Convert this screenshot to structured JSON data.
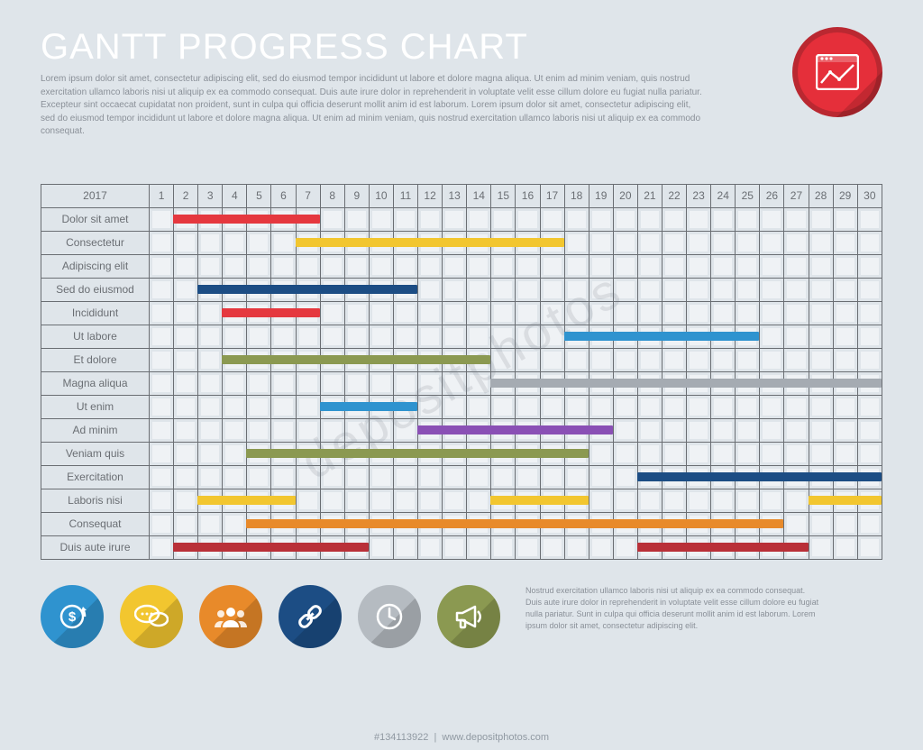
{
  "title": "GANTT PROGRESS CHART",
  "description": "Lorem ipsum dolor sit amet, consectetur adipiscing elit, sed do eiusmod tempor incididunt ut labore et dolore magna aliqua. Ut enim ad minim veniam, quis nostrud exercitation ullamco laboris nisi ut aliquip ex ea commodo consequat. Duis aute irure dolor in reprehenderit in voluptate velit esse cillum dolore eu fugiat nulla pariatur. Excepteur sint occaecat cupidatat non proident, sunt in culpa qui officia deserunt mollit anim id est laborum. Lorem ipsum dolor sit amet, consectetur adipiscing elit, sed do eiusmod tempor incididunt ut labore et dolore magna aliqua. Ut enim ad minim veniam, quis nostrud exercitation ullamco laboris nisi ut aliquip ex ea commodo consequat.",
  "footnote": "Nostrud exercitation ullamco laboris nisi ut aliquip ex ea commodo consequat. Duis aute irure dolor in reprehenderit in voluptate velit esse cillum dolore eu fugiat nulla pariatur. Sunt in culpa qui officia deserunt mollit anim id est laborum. Lorem ipsum dolor sit amet, consectetur adipiscing elit.",
  "watermark": "depositphotos",
  "credits_id": "#134113922",
  "credits_site": "www.depositphotos.com",
  "chart_data": {
    "type": "gantt",
    "year_label": "2017",
    "x": [
      1,
      2,
      3,
      4,
      5,
      6,
      7,
      8,
      9,
      10,
      11,
      12,
      13,
      14,
      15,
      16,
      17,
      18,
      19,
      20,
      21,
      22,
      23,
      24,
      25,
      26,
      27,
      28,
      29,
      30
    ],
    "tasks": [
      {
        "name": "Dolor sit amet",
        "bars": [
          {
            "start": 2,
            "end": 7,
            "color": "#e5383f"
          }
        ]
      },
      {
        "name": "Consectetur",
        "bars": [
          {
            "start": 7,
            "end": 17,
            "color": "#f2c62f"
          }
        ]
      },
      {
        "name": "Adipiscing elit",
        "bars": []
      },
      {
        "name": "Sed do eiusmod",
        "bars": [
          {
            "start": 3,
            "end": 11,
            "color": "#1c4d84"
          }
        ]
      },
      {
        "name": "Incididunt",
        "bars": [
          {
            "start": 4,
            "end": 7,
            "color": "#e5383f"
          }
        ]
      },
      {
        "name": "Ut labore",
        "bars": [
          {
            "start": 18,
            "end": 25,
            "color": "#2f93cf"
          }
        ]
      },
      {
        "name": "Et dolore",
        "bars": [
          {
            "start": 4,
            "end": 14,
            "color": "#8b9951"
          }
        ]
      },
      {
        "name": "Magna aliqua",
        "bars": [
          {
            "start": 15,
            "end": 30,
            "color": "#a5abb2"
          }
        ]
      },
      {
        "name": "Ut enim",
        "bars": [
          {
            "start": 8,
            "end": 11,
            "color": "#2f93cf"
          }
        ]
      },
      {
        "name": "Ad minim",
        "bars": [
          {
            "start": 12,
            "end": 19,
            "color": "#8a50b5"
          }
        ]
      },
      {
        "name": "Veniam quis",
        "bars": [
          {
            "start": 5,
            "end": 18,
            "color": "#8b9951"
          }
        ]
      },
      {
        "name": "Exercitation",
        "bars": [
          {
            "start": 21,
            "end": 30,
            "color": "#1c4d84"
          }
        ]
      },
      {
        "name": "Laboris nisi",
        "bars": [
          {
            "start": 3,
            "end": 6,
            "color": "#f2c62f"
          },
          {
            "start": 15,
            "end": 18,
            "color": "#f2c62f"
          },
          {
            "start": 28,
            "end": 30,
            "color": "#f2c62f"
          }
        ]
      },
      {
        "name": "Consequat",
        "bars": [
          {
            "start": 5,
            "end": 26,
            "color": "#e88a2a"
          }
        ]
      },
      {
        "name": "Duis aute irure",
        "bars": [
          {
            "start": 2,
            "end": 9,
            "color": "#b93038"
          },
          {
            "start": 21,
            "end": 27,
            "color": "#b93038"
          }
        ]
      }
    ]
  },
  "footer_icons": [
    {
      "name": "dollar-icon",
      "bg": "#2f93cf"
    },
    {
      "name": "chat-icon",
      "bg": "#f2c62f"
    },
    {
      "name": "users-icon",
      "bg": "#e88a2a"
    },
    {
      "name": "link-icon",
      "bg": "#1c4d84"
    },
    {
      "name": "clock-icon",
      "bg": "#b5bbc1"
    },
    {
      "name": "megaphone-icon",
      "bg": "#8b9951"
    }
  ]
}
